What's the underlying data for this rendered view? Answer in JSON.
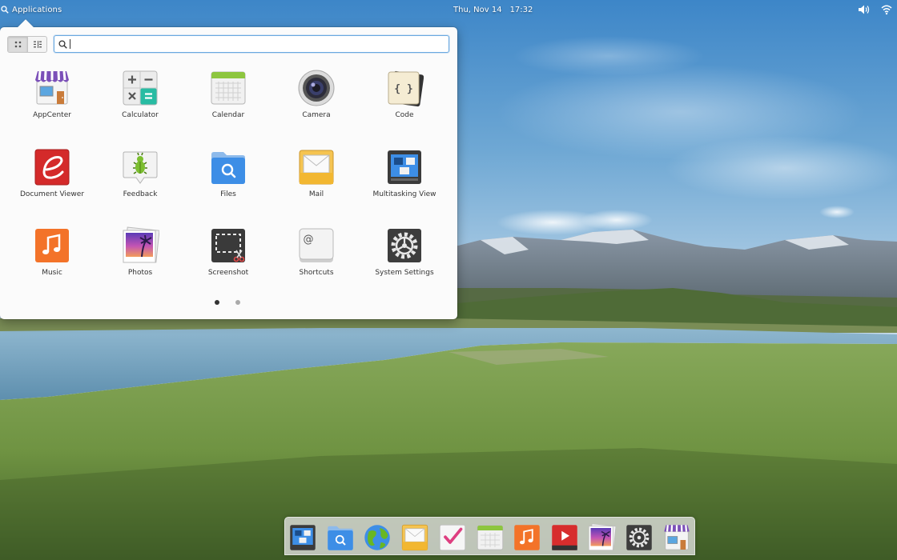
{
  "panel": {
    "applications_label": "Applications",
    "date": "Thu, Nov 14",
    "time": "17:32",
    "indicators": [
      "volume-icon",
      "wifi-icon"
    ]
  },
  "launcher": {
    "view_modes": [
      "grid-view-icon",
      "category-view-icon"
    ],
    "active_view": "grid",
    "search": {
      "value": "",
      "placeholder": ""
    },
    "apps": [
      {
        "label": "AppCenter",
        "icon": "appcenter-icon"
      },
      {
        "label": "Calculator",
        "icon": "calculator-icon"
      },
      {
        "label": "Calendar",
        "icon": "calendar-icon"
      },
      {
        "label": "Camera",
        "icon": "camera-icon"
      },
      {
        "label": "Code",
        "icon": "code-icon"
      },
      {
        "label": "Document Viewer",
        "icon": "document-viewer-icon"
      },
      {
        "label": "Feedback",
        "icon": "feedback-icon"
      },
      {
        "label": "Files",
        "icon": "files-icon"
      },
      {
        "label": "Mail",
        "icon": "mail-icon"
      },
      {
        "label": "Multitasking View",
        "icon": "multitasking-view-icon"
      },
      {
        "label": "Music",
        "icon": "music-icon"
      },
      {
        "label": "Photos",
        "icon": "photos-icon"
      },
      {
        "label": "Screenshot",
        "icon": "screenshot-icon"
      },
      {
        "label": "Shortcuts",
        "icon": "shortcuts-icon"
      },
      {
        "label": "System Settings",
        "icon": "system-settings-icon"
      }
    ],
    "pages": {
      "count": 2,
      "current": 1
    }
  },
  "dock": {
    "items": [
      "multitasking-view-icon",
      "files-icon",
      "web-browser-icon",
      "mail-icon",
      "tasks-icon",
      "calendar-icon",
      "music-icon",
      "videos-icon",
      "photos-icon",
      "system-settings-icon",
      "appcenter-icon"
    ]
  },
  "colors": {
    "accent": "#3689e6",
    "popover_bg": "#fbfbfb",
    "search_focus": "#6aa9e0"
  }
}
